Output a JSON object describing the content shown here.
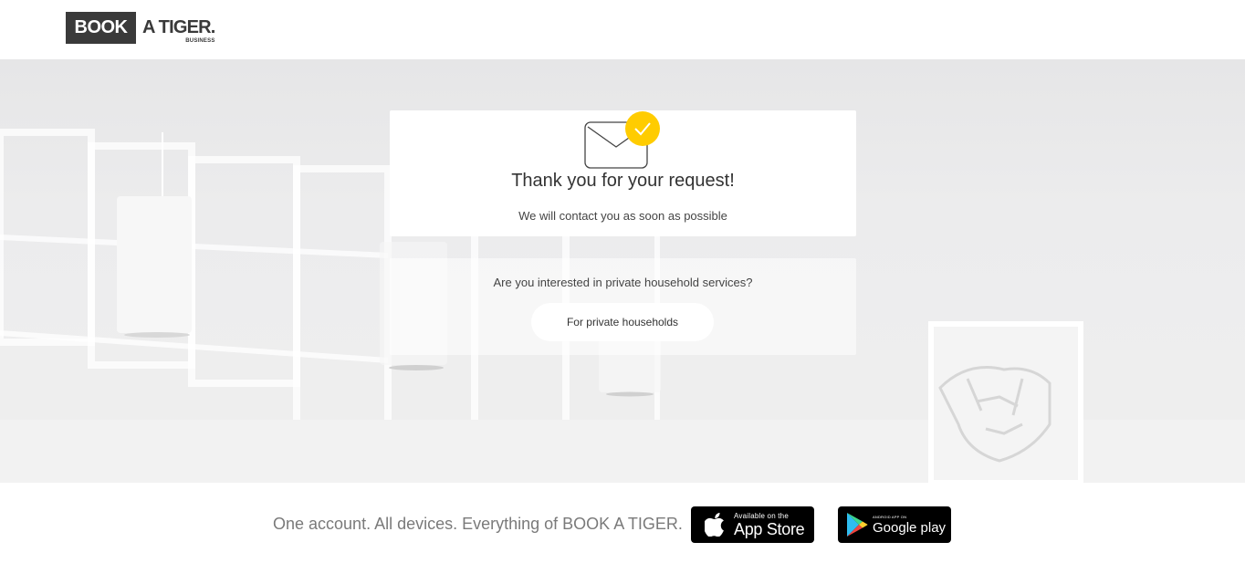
{
  "header": {
    "logo_book": "BOOK",
    "logo_tiger": "A TIGER.",
    "logo_business": "BUSINESS"
  },
  "confirmation": {
    "icon": "envelope-check-icon",
    "accent_color": "#ffcc00",
    "title": "Thank you for your request!",
    "subtitle": "We will contact you as soon as possible"
  },
  "private": {
    "question": "Are you interested in private household services?",
    "button_label": "For private households"
  },
  "footer": {
    "tagline": "One account. All devices. Everything of BOOK A TIGER.",
    "app_store": {
      "small": "Available on the",
      "big": "App Store",
      "icon": "apple-icon"
    },
    "google_play": {
      "small": "ANDROID APP ON",
      "big": "Google play",
      "icon": "google-play-icon"
    }
  }
}
